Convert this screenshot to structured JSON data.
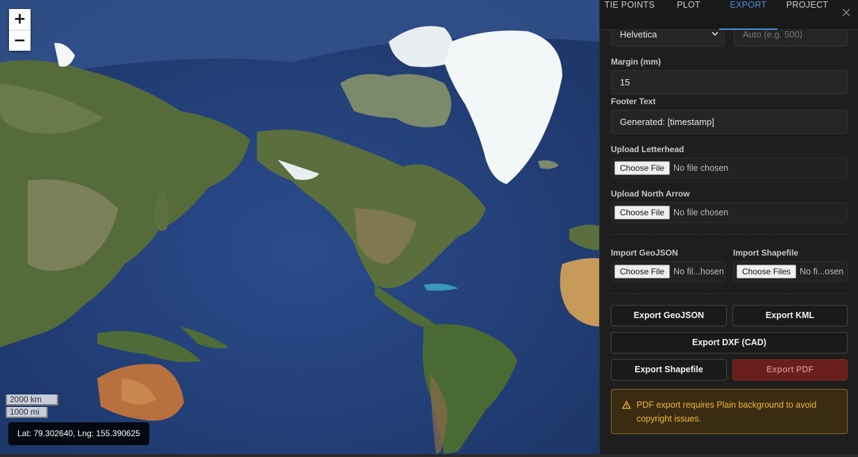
{
  "map": {
    "zoom_in": "+",
    "zoom_out": "−",
    "scale_km": "2000 km",
    "scale_mi": "1000 mi",
    "coordinates": "Lat: 79.302640, Lng: 155.390625"
  },
  "panel": {
    "tabs": [
      {
        "label": "TIE POINTS",
        "active": false
      },
      {
        "label": "PLOT",
        "active": false
      },
      {
        "label": "EXPORT",
        "active": true
      },
      {
        "label": "PROJECT",
        "active": false
      }
    ],
    "font_select": {
      "value": "Helvetica"
    },
    "font_size": {
      "placeholder": "Auto (e.g. 500)"
    },
    "margin": {
      "label": "Margin (mm)",
      "value": "15"
    },
    "footer": {
      "label": "Footer Text",
      "value": "Generated: [timestamp]"
    },
    "letterhead": {
      "label": "Upload Letterhead",
      "button": "Choose File",
      "status": "No file chosen"
    },
    "north_arrow": {
      "label": "Upload North Arrow",
      "button": "Choose File",
      "status": "No file chosen"
    },
    "import_geojson": {
      "label": "Import GeoJSON",
      "button": "Choose File",
      "status": "No fil...hosen"
    },
    "import_shapefile": {
      "label": "Import Shapefile",
      "button": "Choose Files",
      "status": "No fi...osen"
    },
    "buttons": {
      "geojson": "Export GeoJSON",
      "kml": "Export KML",
      "dxf": "Export DXF (CAD)",
      "shapefile": "Export Shapefile",
      "pdf": "Export PDF"
    },
    "warning": "PDF export requires Plain background to avoid copyright issues."
  },
  "colors": {
    "accent": "#4a90e2",
    "warning_text": "#f1b73a",
    "warning_bg": "#3a2c12",
    "disabled_pdf": "#6b1e1e"
  }
}
